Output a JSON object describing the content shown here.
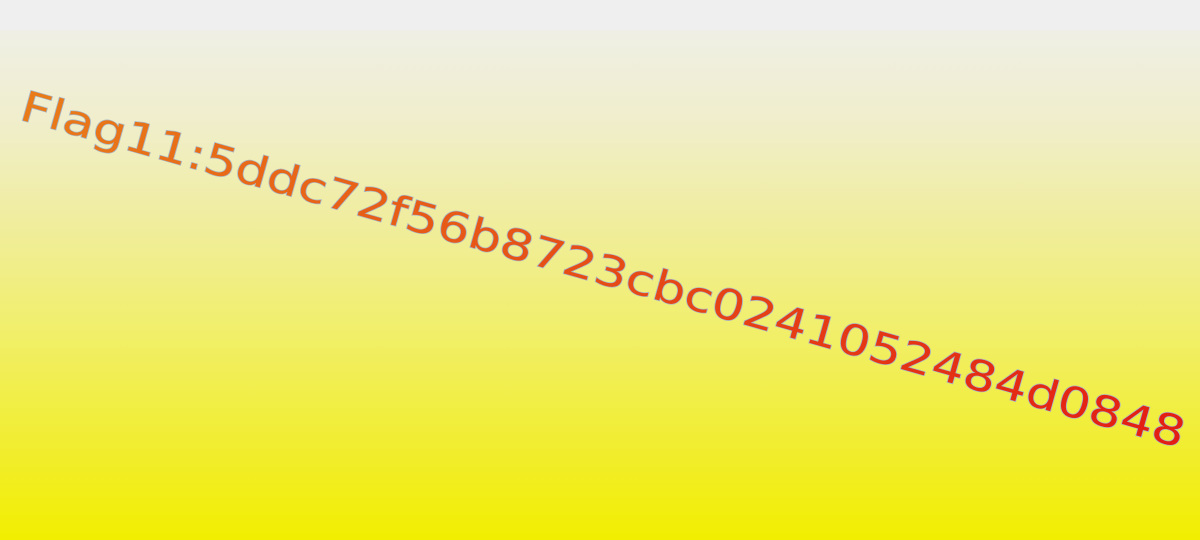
{
  "banner": {
    "text": "Flag11:5ddc72f56b8723cbc0241052484d0848",
    "text_color_start": "#e97b18",
    "text_color_end": "#e31a12",
    "stroke_color": "#a7b7c8",
    "background_top": "#efefef",
    "background_bottom": "#f2ee00"
  }
}
